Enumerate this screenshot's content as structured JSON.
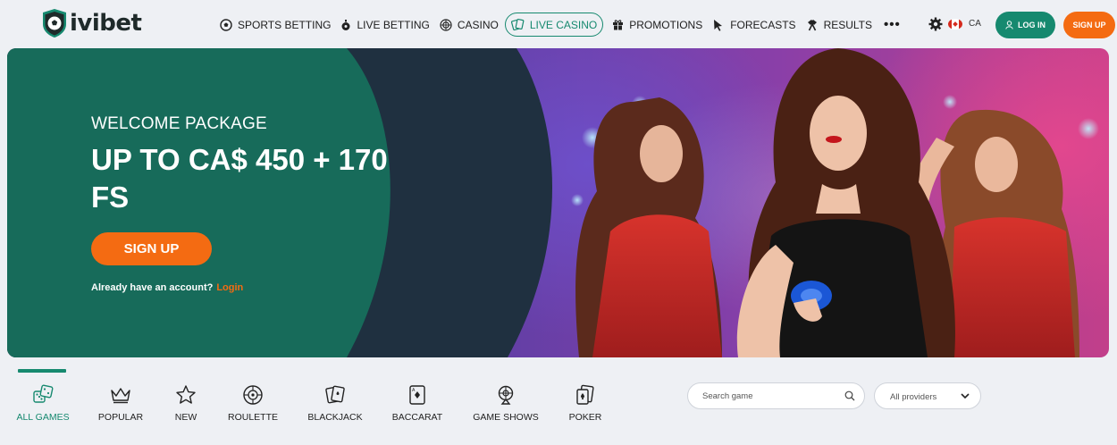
{
  "brand": {
    "name": "ivibet"
  },
  "nav": {
    "items": [
      {
        "label": "SPORTS BETTING",
        "icon": "soccer-ball-icon"
      },
      {
        "label": "LIVE BETTING",
        "icon": "stopwatch-icon"
      },
      {
        "label": "CASINO",
        "icon": "roulette-icon"
      },
      {
        "label": "LIVE CASINO",
        "icon": "cards-icon",
        "active": true
      },
      {
        "label": "PROMOTIONS",
        "icon": "gift-icon"
      },
      {
        "label": "FORECASTS",
        "icon": "cursor-icon"
      },
      {
        "label": "RESULTS",
        "icon": "hammer-icon"
      }
    ],
    "more": "•••"
  },
  "header": {
    "region": "CA",
    "login_label": "LOG IN",
    "signup_label": "SIGN UP"
  },
  "banner": {
    "welcome": "WELCOME PACKAGE",
    "bonus": "UP TO CA$ 450 + 170 FS",
    "signup_label": "SIGN UP",
    "account_text": "Already have an account?",
    "login_link": "Login"
  },
  "categories": [
    {
      "label": "ALL GAMES",
      "icon": "dice-icon",
      "active": true
    },
    {
      "label": "POPULAR",
      "icon": "crown-icon"
    },
    {
      "label": "NEW",
      "icon": "star-icon"
    },
    {
      "label": "ROULETTE",
      "icon": "roulette-wheel-icon"
    },
    {
      "label": "BLACKJACK",
      "icon": "blackjack-cards-icon"
    },
    {
      "label": "BACCARAT",
      "icon": "baccarat-card-icon"
    },
    {
      "label": "GAME SHOWS",
      "icon": "game-show-icon"
    },
    {
      "label": "POKER",
      "icon": "poker-cards-icon"
    }
  ],
  "filters": {
    "search_placeholder": "Search game",
    "providers_value": "All providers"
  },
  "colors": {
    "brand_green": "#16896f",
    "accent_orange": "#f46b12",
    "banner_green": "#176b5a"
  }
}
